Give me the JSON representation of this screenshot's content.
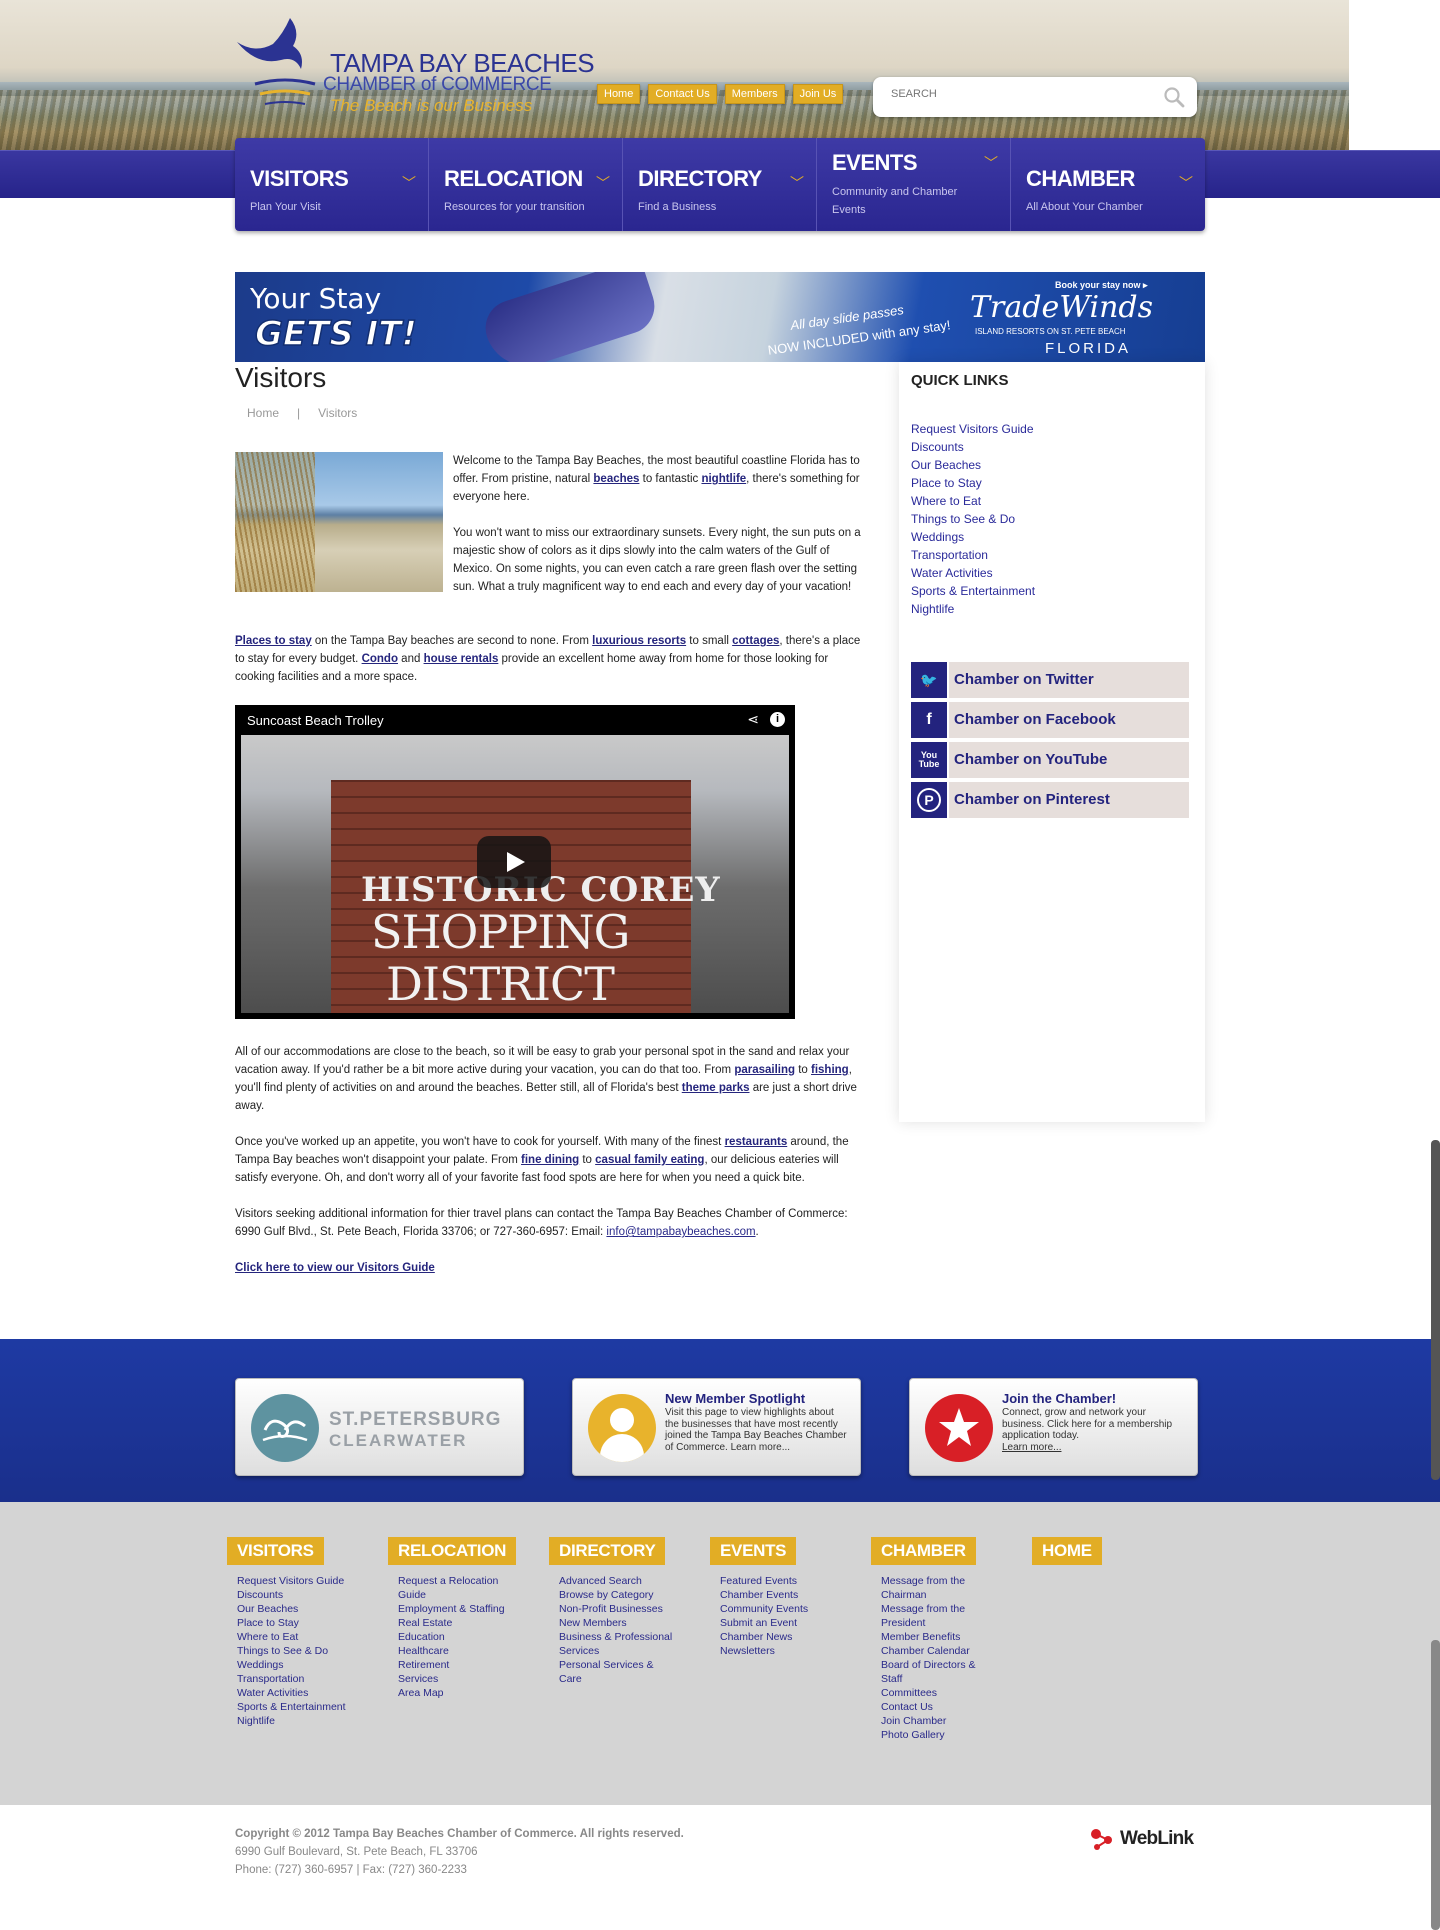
{
  "header": {
    "logo_line1": "TAMPA BAY BEACHES",
    "logo_line2": "CHAMBER of COMMERCE",
    "logo_tagline": "The Beach is our Business",
    "top_links": [
      "Home",
      "Contact Us",
      "Members",
      "Join Us"
    ],
    "search_placeholder": "SEARCH"
  },
  "nav": [
    {
      "title": "VISITORS",
      "subtitle": "Plan Your Visit"
    },
    {
      "title": "RELOCATION",
      "subtitle": "Resources for your transition"
    },
    {
      "title": "DIRECTORY",
      "subtitle": "Find a Business"
    },
    {
      "title": "EVENTS",
      "subtitle": "Community and Chamber Events"
    },
    {
      "title": "CHAMBER",
      "subtitle": "All About Your Chamber"
    }
  ],
  "banner": {
    "line1": "Your Stay",
    "line2": "GETS IT!",
    "passes": "All day slide passes",
    "included": "NOW INCLUDED with any stay!",
    "book": "Book your stay now ▸",
    "brand": "TradeWinds",
    "brand_sub": "ISLAND RESORTS ON ST. PETE BEACH",
    "brand_state": "FLORIDA"
  },
  "page": {
    "title": "Visitors",
    "breadcrumb": [
      "Home",
      "|",
      "Visitors"
    ]
  },
  "intro": {
    "p1_a": "Welcome to the Tampa Bay Beaches, the most beautiful coastline Florida has to offer. From pristine, natural ",
    "p1_link1": "beaches",
    "p1_b": " to fantastic ",
    "p1_link2": "nightlife",
    "p1_c": ", there's something for everyone here.",
    "p2": "You won't want to miss our extraordinary sunsets. Every night, the sun puts on a majestic show of colors as it dips slowly into the calm waters of the Gulf of Mexico. On some nights, you can even catch a rare green flash over the setting sun. What a truly magnificent way to end each and every day of your vacation!"
  },
  "places": {
    "link1": "Places to stay",
    "t1": " on the Tampa Bay beaches are second to none. From ",
    "link2": "luxurious resorts",
    "t2": " to small ",
    "link3": "cottages",
    "t3": ", there's a place to stay for every budget.  ",
    "link4": "Condo",
    "t4": " and ",
    "link5": "house rentals",
    "t5": " provide an excellent home away from home for those looking for cooking facilities and a more space."
  },
  "video": {
    "title": "Suncoast Beach Trolley",
    "sign1": "HISTORIC COREY",
    "sign2": "SHOPPING",
    "sign3": "DISTRICT"
  },
  "body": {
    "p3_a": "All of our accommodations are close to the beach, so it will be easy to grab your personal spot in the sand and relax your vacation away. If you'd rather be a bit more active during your vacation, you can do that too. From ",
    "p3_link1": "parasailing",
    "p3_b": " to ",
    "p3_link2": "fishing",
    "p3_c": ", you'll find plenty of activities on and around the beaches. Better still, all of Florida's best ",
    "p3_link3": "theme parks",
    "p3_d": " are just a short drive away.",
    "p4_a": "Once you've worked up an appetite, you won't have to cook for yourself. With many of the finest ",
    "p4_link1": "restaurants",
    "p4_b": " around, the Tampa Bay beaches won't disappoint your palate. From ",
    "p4_link2": "fine dining",
    "p4_c": " to ",
    "p4_link3": "casual family eating",
    "p4_d": ", our delicious eateries will satisfy everyone. Oh, and don't worry all of your favorite fast food spots are here for when you need a quick bite.",
    "p5_a": "Visitors seeking additional information for thier travel plans can contact the Tampa Bay Beaches Chamber of Commerce: 6990 Gulf Blvd., St. Pete Beach, Florida 33706; or 727-360-6957: Email:  ",
    "p5_email": "info@tampabaybeaches.com",
    "p5_b": ".",
    "guide_link": "Click here to view our Visitors Guide"
  },
  "sidebar": {
    "title": "QUICK LINKS",
    "links": [
      "Request Visitors Guide",
      "Discounts",
      "Our Beaches",
      "Place to Stay",
      "Where to Eat",
      "Things to See & Do",
      "Weddings",
      "Transportation",
      "Water Activities",
      "Sports & Entertainment",
      "Nightlife"
    ],
    "social": [
      {
        "icon": "twitter-icon",
        "glyph": "🐦",
        "label": "Chamber on Twitter"
      },
      {
        "icon": "facebook-icon",
        "glyph": "f",
        "label": "Chamber on Facebook"
      },
      {
        "icon": "youtube-icon",
        "glyph": "You Tube",
        "label": "Chamber on YouTube"
      },
      {
        "icon": "pinterest-icon",
        "glyph": "P",
        "label": "Chamber on Pinterest"
      }
    ]
  },
  "cards": {
    "stpete_1": "ST.PETERSBURG",
    "stpete_2": "CLEARWATER",
    "spotlight_title": "New Member Spotlight",
    "spotlight_text": "Visit this page to view highlights about the businesses that have most recently joined the Tampa Bay Beaches Chamber of Commerce. Learn more...",
    "join_title": "Join the Chamber!",
    "join_text": "Connect, grow and network your business. Click here for a membership application today.",
    "join_more": "Learn more..."
  },
  "footer_cols": [
    {
      "head": "VISITORS",
      "items": [
        "Request Visitors Guide",
        "Discounts",
        "Our Beaches",
        "Place to Stay",
        "Where to Eat",
        "Things to See & Do",
        "Weddings",
        "Transportation",
        "Water Activities",
        "Sports & Entertainment",
        "Nightlife"
      ]
    },
    {
      "head": "RELOCATION",
      "items": [
        "Request a Relocation Guide",
        "Employment & Staffing",
        "Real Estate",
        "Education",
        "Healthcare",
        "Retirement Services",
        "Area Map"
      ]
    },
    {
      "head": "DIRECTORY",
      "items": [
        "Advanced Search",
        "Browse by Category",
        "Non-Profit Businesses",
        "New Members",
        "Business & Professional Services",
        "Personal Services & Care"
      ]
    },
    {
      "head": "EVENTS",
      "items": [
        "Featured Events",
        "Chamber Events",
        "Community Events",
        "Submit an Event",
        "Chamber News",
        "Newsletters"
      ]
    },
    {
      "head": "CHAMBER",
      "items": [
        "Message from the Chairman",
        "Message from the President",
        "Member Benefits",
        "Chamber Calendar",
        "Board of Directors & Staff",
        "Committees",
        "Contact Us",
        "Join Chamber",
        "Photo Gallery"
      ]
    },
    {
      "head": "HOME",
      "items": []
    }
  ],
  "copyright": {
    "line1": "Copyright © 2012 Tampa Bay Beaches Chamber of Commerce.  All rights reserved.",
    "line2": "6990 Gulf Boulevard, St. Pete Beach, FL 33706",
    "line3": "Phone: (727) 360-6957 | Fax: (727) 360-2233",
    "weblink": "WebLink"
  },
  "colors": {
    "nav_purple": "#2e2a95",
    "accent_gold": "#e2ad25",
    "footer_blue": "#1e3aa3",
    "link_blue": "#25257d"
  }
}
